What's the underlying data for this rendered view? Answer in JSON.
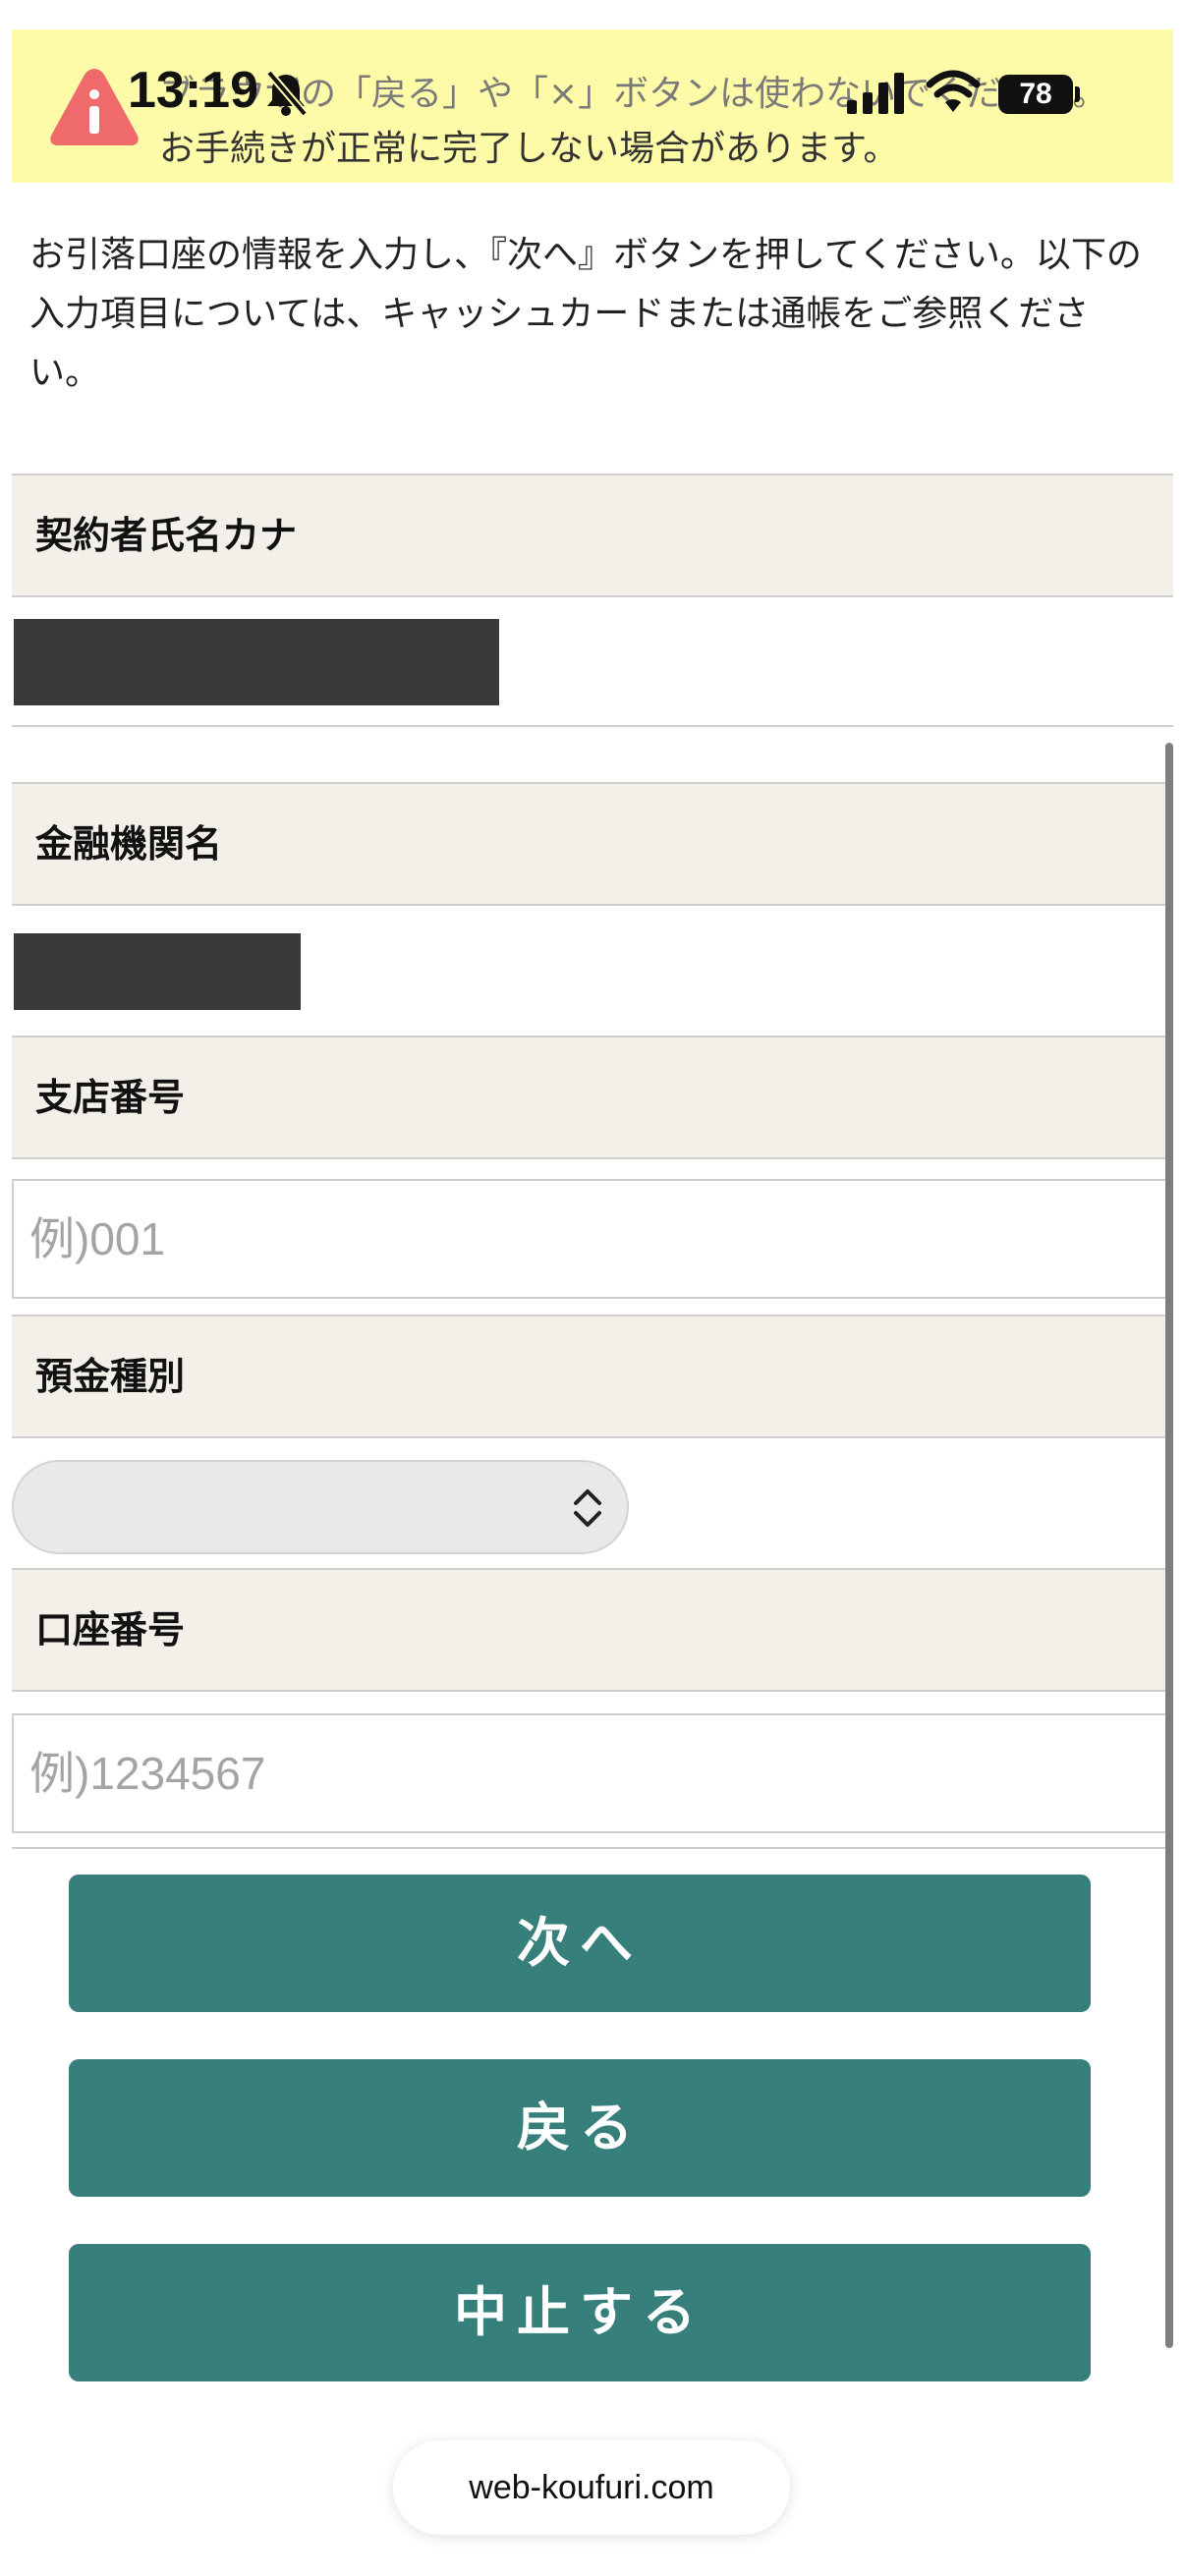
{
  "status_bar": {
    "time": "13:19",
    "battery": "78",
    "icons": [
      "bell-slash-icon",
      "signal-icon",
      "wifi-icon",
      "battery-icon"
    ]
  },
  "warning_banner": {
    "line1": "ブラウザの「戻る」や「×」ボタンは使わないでください。",
    "line2": "お手続きが正常に完了しない場合があります。",
    "icon": "info-triangle-icon",
    "color": "#fdfaa8"
  },
  "intro": "お引落口座の情報を入力し、『次へ』ボタンを押してください。以下の入力項目については、キャッシュカードまたは通帳をご参照ください。",
  "form": {
    "contract_name_kana": {
      "label": "契約者氏名カナ"
    },
    "bank_name": {
      "label": "金融機関名"
    },
    "branch_number": {
      "label": "支店番号",
      "placeholder": "例)001",
      "value": ""
    },
    "deposit_type": {
      "label": "預金種別",
      "selected": ""
    },
    "account_number": {
      "label": "口座番号",
      "placeholder": "例)1234567",
      "value": ""
    }
  },
  "buttons": {
    "next": "次へ",
    "back": "戻る",
    "cancel": "中止する",
    "color": "#377f7b"
  },
  "browser": {
    "url": "web-koufuri.com"
  }
}
